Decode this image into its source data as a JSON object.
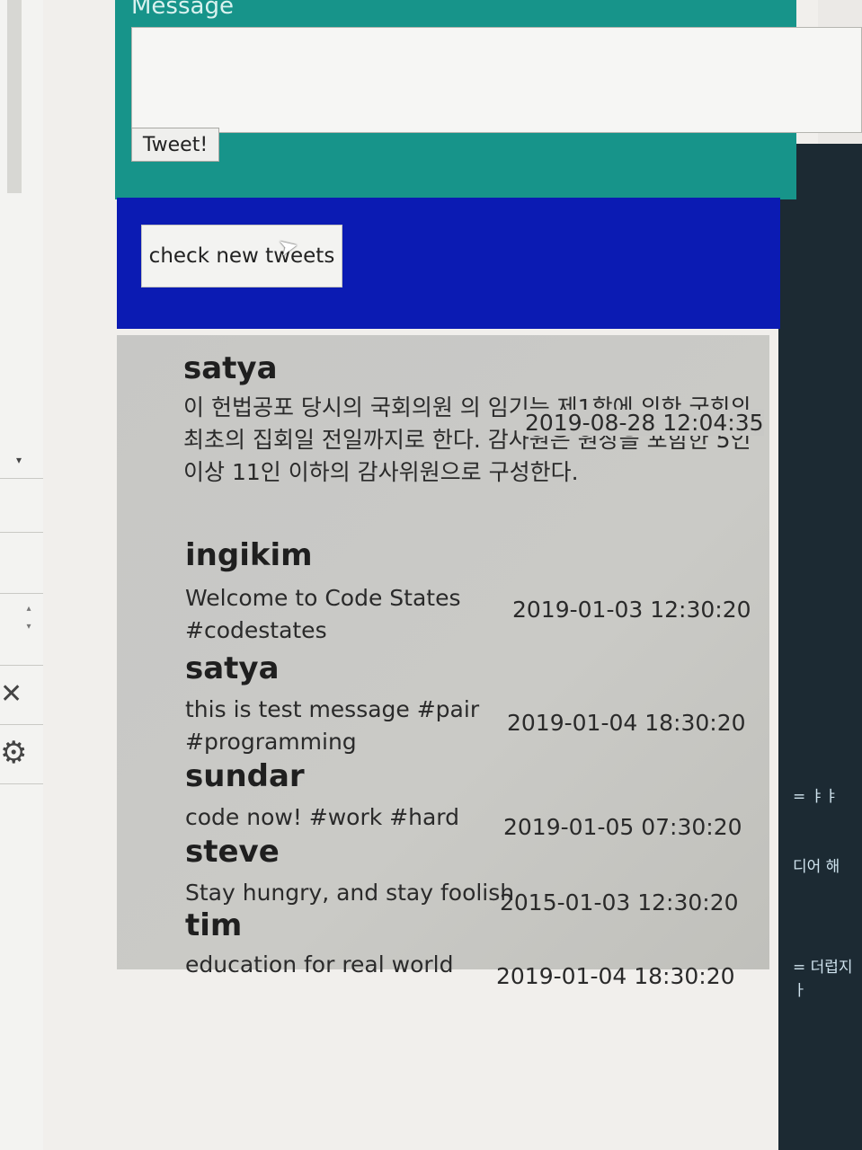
{
  "sidebar": {
    "close_glyph": "✕",
    "gear_glyph": "⚙",
    "caret_glyph": "▾"
  },
  "form": {
    "message_label": "Message",
    "message_value": "",
    "tweet_button": "Tweet!"
  },
  "check": {
    "button_label": "check new tweets"
  },
  "tweets": [
    {
      "user": "satya",
      "message": "이 헌법공포 당시의 국회의원 의 임기는 제1항에 의한 국회의 최초의 집회일 전일까지로 한다. 감사원은 원장을 포함한 5인 이상 11인 이하의 감사위원으로 구성한다.",
      "date": "2019-08-28 12:04:35"
    },
    {
      "user": "ingikim",
      "message": "Welcome to Code States #codestates",
      "date": "2019-01-03 12:30:20"
    },
    {
      "user": "satya",
      "message": "this is test message #pair #programming",
      "date": "2019-01-04 18:30:20"
    },
    {
      "user": "sundar",
      "message": "code now! #work #hard",
      "date": "2019-01-05 07:30:20"
    },
    {
      "user": "steve",
      "message": "Stay hungry, and stay foolish",
      "date": "2015-01-03 12:30:20"
    },
    {
      "user": "tim",
      "message": "education for real world",
      "date": "2019-01-04 18:30:20"
    }
  ],
  "right_panel": {
    "lines": [
      "= ㅑㅑ",
      "디어 해",
      "= 더럽지",
      "ㅏ"
    ]
  },
  "colors": {
    "form_bg": "#17948a",
    "check_bar_bg": "#0b1bb3",
    "list_bg": "#c7c7c5"
  }
}
